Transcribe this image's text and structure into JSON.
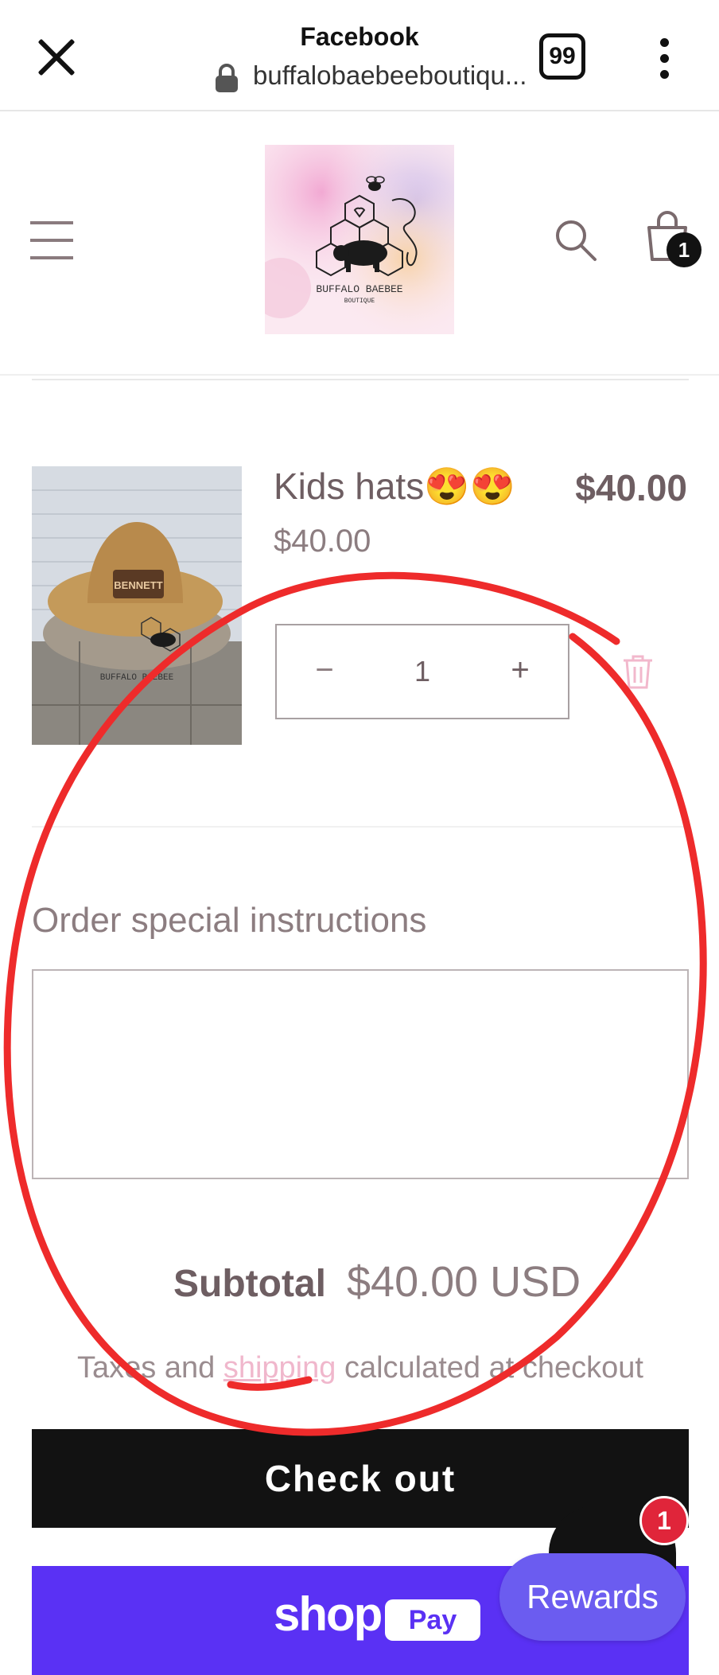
{
  "browser": {
    "title": "Facebook",
    "url": "buffalobaebeeboutiqu...",
    "tab_count": "99"
  },
  "store": {
    "logo_alt": "BUFFALO BAEBEE BOUTIQUE",
    "logo_line1": "BUFFALO BAEBEE",
    "logo_line2": "BOUTIQUE",
    "cart_count": "1"
  },
  "cart": {
    "item": {
      "title": "Kids hats😍😍",
      "price": "$40.00",
      "line_total": "$40.00",
      "quantity": "1",
      "minus": "−",
      "plus": "+",
      "image_patch_text": "BENNETT",
      "image_logo_text": "BUFFALO BAEBEE"
    },
    "notes_label": "Order special instructions",
    "notes_value": "",
    "subtotal_label": "Subtotal",
    "subtotal_value": "$40.00 USD",
    "tax_prefix": "Taxes and ",
    "tax_link": "shipping",
    "tax_suffix": " calculated at checkout",
    "checkout_label": "Check out"
  },
  "shoppay": {
    "shop": "shop",
    "pay": "Pay"
  },
  "widgets": {
    "chat_badge": "1",
    "rewards_label": "Rewards"
  },
  "colors": {
    "accent_purple": "#5a31f4",
    "checkout_black": "#121212",
    "annotation_red": "#ee2b2b",
    "link_pink": "#f0b7cc"
  }
}
